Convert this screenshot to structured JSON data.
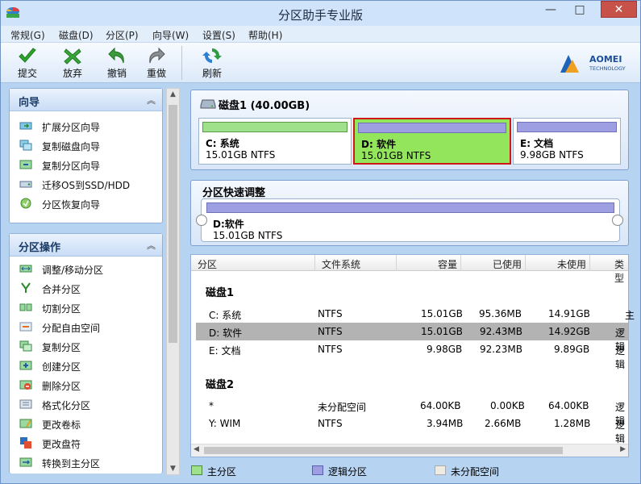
{
  "window": {
    "title": "分区助手专业版",
    "minimize": "—",
    "maximize": "□",
    "close": "✕"
  },
  "menu": [
    "常规(G)",
    "磁盘(D)",
    "分区(P)",
    "向导(W)",
    "设置(S)",
    "帮助(H)"
  ],
  "toolbar": {
    "commit": "提交",
    "discard": "放弃",
    "undo": "撤销",
    "redo": "重做",
    "refresh": "刷新"
  },
  "logo": {
    "name": "AOMEI",
    "sub": "TECHNOLOGY"
  },
  "wizard_panel": {
    "title": "向导",
    "items": [
      "扩展分区向导",
      "复制磁盘向导",
      "复制分区向导",
      "迁移OS到SSD/HDD",
      "分区恢复向导"
    ]
  },
  "ops_panel": {
    "title": "分区操作",
    "items": [
      "调整/移动分区",
      "合并分区",
      "切割分区",
      "分配自由空间",
      "复制分区",
      "创建分区",
      "删除分区",
      "格式化分区",
      "更改卷标",
      "更改盘符",
      "转换到主分区"
    ]
  },
  "disk_map": {
    "header": "磁盘1 (40.00GB)",
    "partitions": [
      {
        "name": "C: 系统",
        "size": "15.01GB NTFS"
      },
      {
        "name": "D: 软件",
        "size": "15.01GB NTFS"
      },
      {
        "name": "E: 文档",
        "size": "9.98GB NTFS"
      }
    ]
  },
  "quick_adjust": {
    "title": "分区快速调整",
    "name": "D:软件",
    "size": "15.01GB NTFS"
  },
  "table": {
    "columns": [
      "分区",
      "文件系统",
      "容量",
      "已使用",
      "未使用",
      "类型"
    ],
    "disk1": "磁盘1",
    "disk1_rows": [
      [
        "C: 系统",
        "NTFS",
        "15.01GB",
        "95.36MB",
        "14.91GB",
        "主"
      ],
      [
        "D: 软件",
        "NTFS",
        "15.01GB",
        "92.43MB",
        "14.92GB",
        "逻辑"
      ],
      [
        "E: 文档",
        "NTFS",
        "9.98GB",
        "92.23MB",
        "9.89GB",
        "逻辑"
      ]
    ],
    "disk2": "磁盘2",
    "disk2_rows": [
      [
        "*",
        "未分配空间",
        "64.00KB",
        "0.00KB",
        "64.00KB",
        "逻辑"
      ],
      [
        "Y: WIM",
        "NTFS",
        "3.94MB",
        "2.66MB",
        "1.28MB",
        "逻辑"
      ]
    ]
  },
  "legend": {
    "primary": "主分区",
    "logical": "逻辑分区",
    "unallocated": "未分配空间"
  },
  "colors": {
    "primary": "#9fe08a",
    "logical": "#9d9fe2",
    "selected": "#93e55b",
    "unallocated": "#efebe3"
  }
}
